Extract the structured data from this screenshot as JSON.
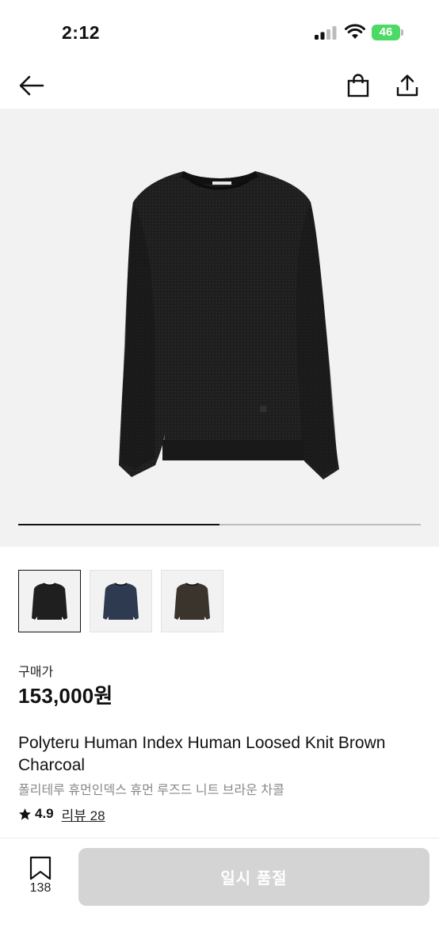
{
  "status_bar": {
    "time": "2:12",
    "battery_level": "46"
  },
  "nav": {
    "back_icon": "arrow-left-icon",
    "bag_icon": "shopping-bag-icon",
    "share_icon": "share-icon"
  },
  "gallery": {
    "progress": 0.5,
    "thumbnails": [
      {
        "color": "#1f1f1f",
        "selected": true
      },
      {
        "color": "#2e3a50",
        "selected": false
      },
      {
        "color": "#3a342c",
        "selected": false
      }
    ]
  },
  "product": {
    "price_label": "구매가",
    "price": "153,000원",
    "title": "Polyteru Human Index Human Loosed Knit Brown Charcoal",
    "subtitle": "폴리테루 휴먼인덱스 휴먼 루즈드 니트 브라운 차콜",
    "rating": "4.9",
    "review_link": "리뷰 28"
  },
  "bottom_bar": {
    "wish_count": "138",
    "cta_label": "일시 품절"
  }
}
